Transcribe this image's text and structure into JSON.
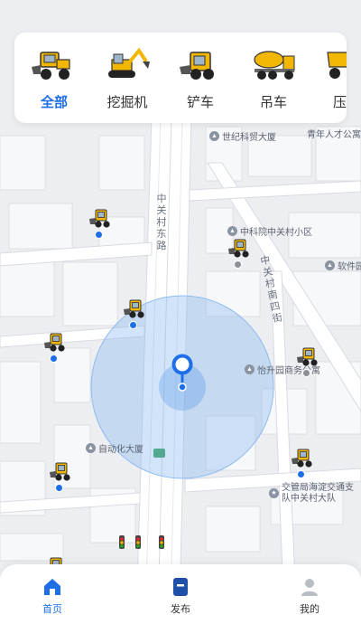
{
  "categories": [
    {
      "label": "全部",
      "icon": "wheel-loader-icon",
      "active": true
    },
    {
      "label": "挖掘机",
      "icon": "excavator-icon",
      "active": false
    },
    {
      "label": "铲车",
      "icon": "skid-steer-icon",
      "active": false
    },
    {
      "label": "吊车",
      "icon": "mixer-truck-icon",
      "active": false
    },
    {
      "label": "压路",
      "icon": "dump-truck-icon",
      "active": false
    }
  ],
  "map": {
    "pois": [
      {
        "name": "世纪科贸大厦"
      },
      {
        "name": "青年人才公寓"
      },
      {
        "name": "中科院中关村小区"
      },
      {
        "name": "软件园"
      },
      {
        "name": "怡升园商务公寓"
      },
      {
        "name": "自动化大厦"
      },
      {
        "name": "交管局海淀交通支队中关村大队"
      }
    ],
    "streets": [
      {
        "name": "中关村东路"
      },
      {
        "name": "中关村南四街"
      }
    ]
  },
  "bottom_nav": [
    {
      "label": "首页",
      "icon": "home-icon",
      "active": true
    },
    {
      "label": "发布",
      "icon": "publish-icon",
      "active": false
    },
    {
      "label": "我的",
      "icon": "profile-icon",
      "active": false
    }
  ],
  "colors": {
    "accent": "#1d6ee8",
    "machine": "#f2b705",
    "machine_dot": "#1e6fe6",
    "idle_dot": "#8b8f96"
  }
}
